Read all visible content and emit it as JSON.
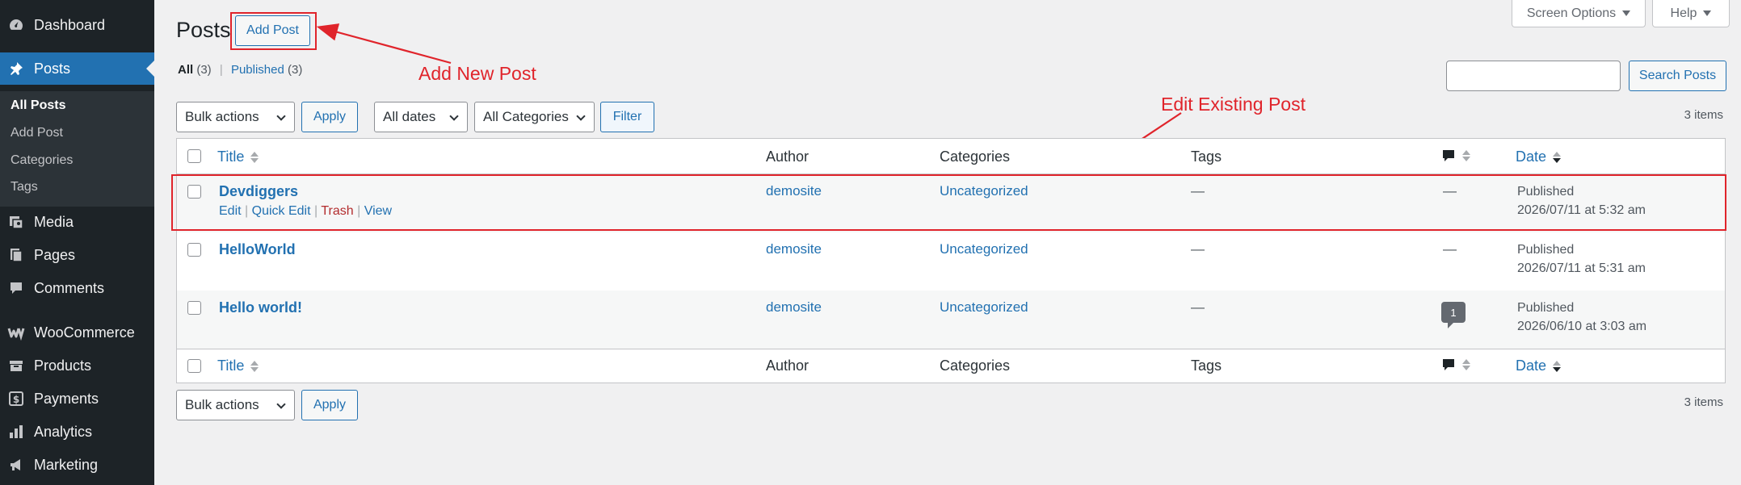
{
  "sidebar": {
    "items": [
      {
        "label": "Dashboard",
        "icon": "dashboard-icon"
      },
      {
        "label": "Posts",
        "icon": "pushpin-icon",
        "active": true
      },
      {
        "label": "Media",
        "icon": "media-icon"
      },
      {
        "label": "Pages",
        "icon": "pages-icon"
      },
      {
        "label": "Comments",
        "icon": "comments-icon"
      },
      {
        "label": "WooCommerce",
        "icon": "woocommerce-icon"
      },
      {
        "label": "Products",
        "icon": "products-icon"
      },
      {
        "label": "Payments",
        "icon": "payments-icon"
      },
      {
        "label": "Analytics",
        "icon": "analytics-icon"
      },
      {
        "label": "Marketing",
        "icon": "marketing-icon"
      }
    ],
    "submenu": [
      "All Posts",
      "Add Post",
      "Categories",
      "Tags"
    ]
  },
  "top_tabs": {
    "screen_options": "Screen Options",
    "help": "Help"
  },
  "header": {
    "title": "Posts",
    "add_post": "Add Post"
  },
  "annotations": {
    "add_new_post": "Add New Post",
    "edit_existing_post": "Edit Existing Post",
    "color": "#e0242b"
  },
  "filters": {
    "all_label": "All",
    "all_count": "(3)",
    "separator": "|",
    "published_label": "Published",
    "published_count": "(3)",
    "search_button": "Search Posts",
    "bulk_actions": "Bulk actions",
    "apply": "Apply",
    "all_dates": "All dates",
    "all_categories": "All Categories",
    "filter": "Filter",
    "items_count": "3 items"
  },
  "table": {
    "columns": {
      "title": "Title",
      "author": "Author",
      "categories": "Categories",
      "tags": "Tags",
      "date": "Date"
    },
    "row_actions": {
      "edit": "Edit",
      "quick_edit": "Quick Edit",
      "trash": "Trash",
      "view": "View",
      "sep": "|"
    },
    "rows": [
      {
        "title": "Devdiggers",
        "author": "demosite",
        "category": "Uncategorized",
        "tags": "—",
        "comments": "—",
        "status": "Published",
        "date": "2026/07/11 at 5:32 am"
      },
      {
        "title": "HelloWorld",
        "author": "demosite",
        "category": "Uncategorized",
        "tags": "—",
        "comments": "—",
        "status": "Published",
        "date": "2026/07/11 at 5:31 am"
      },
      {
        "title": "Hello world!",
        "author": "demosite",
        "category": "Uncategorized",
        "tags": "—",
        "comments": "1",
        "status": "Published",
        "date": "2026/06/10 at 3:03 am"
      }
    ]
  },
  "colors": {
    "sidebar_bg": "#1d2327",
    "accent": "#2271b1",
    "trash": "#b32d2e"
  }
}
